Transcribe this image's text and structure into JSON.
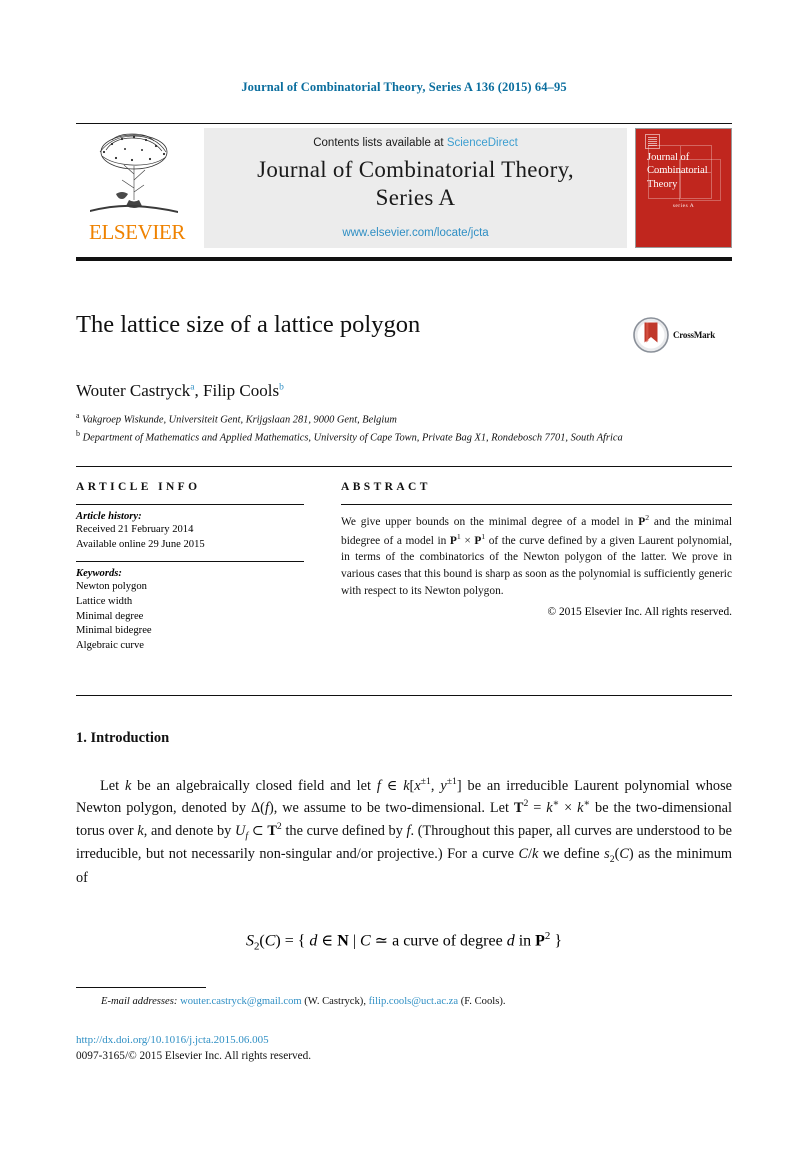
{
  "running_head": "Journal of Combinatorial Theory, Series A 136 (2015) 64–95",
  "masthead": {
    "contents_prefix": "Contents lists available at ",
    "sciencedirect": "ScienceDirect",
    "journal_title_line1": "Journal of Combinatorial Theory,",
    "journal_title_line2": "Series A",
    "journal_url": "www.elsevier.com/locate/jcta",
    "publisher_wordmark": "ELSEVIER",
    "cover": {
      "title": "Journal of Combinatorial Theory",
      "series": "series A"
    }
  },
  "article": {
    "title": "The lattice size of a lattice polygon",
    "authors": [
      {
        "name": "Wouter Castryck",
        "marker": "a"
      },
      {
        "name": "Filip Cools",
        "marker": "b"
      }
    ],
    "authors_separator": ", ",
    "affiliations": [
      {
        "marker": "a",
        "text": "Vakgroep Wiskunde, Universiteit Gent, Krijgslaan 281, 9000 Gent, Belgium"
      },
      {
        "marker": "b",
        "text": "Department of Mathematics and Applied Mathematics, University of Cape Town, Private Bag X1, Rondebosch 7701, South Africa"
      }
    ],
    "crossmark_label": "CrossMark"
  },
  "info": {
    "heading": "ARTICLE INFO",
    "history_label": "Article history:",
    "history_lines": [
      "Received 21 February 2014",
      "Available online 29 June 2015"
    ],
    "keywords_label": "Keywords:",
    "keywords": [
      "Newton polygon",
      "Lattice width",
      "Minimal degree",
      "Minimal bidegree",
      "Algebraic curve"
    ]
  },
  "abstract": {
    "heading": "ABSTRACT",
    "copyright": "© 2015 Elsevier Inc. All rights reserved."
  },
  "body": {
    "section_number_title": "1. Introduction"
  },
  "footnote": {
    "email_label": "E-mail addresses:",
    "emails": [
      {
        "address": "wouter.castryck@gmail.com",
        "attribution": "(W. Castryck)"
      },
      {
        "address": "filip.cools@uct.ac.za",
        "attribution": "(F. Cools)"
      }
    ],
    "doi": "http://dx.doi.org/10.1016/j.jcta.2015.06.005",
    "issn_copyright": "0097-3165/© 2015 Elsevier Inc. All rights reserved."
  },
  "colors": {
    "link_blue": "#2f8fc4",
    "header_blue": "#0b6e9e",
    "sciencedirect_blue": "#3c9ed0",
    "elsevier_orange": "#ef8200",
    "cover_red": "#c0261e",
    "crossmark_red": "#c0392b"
  }
}
